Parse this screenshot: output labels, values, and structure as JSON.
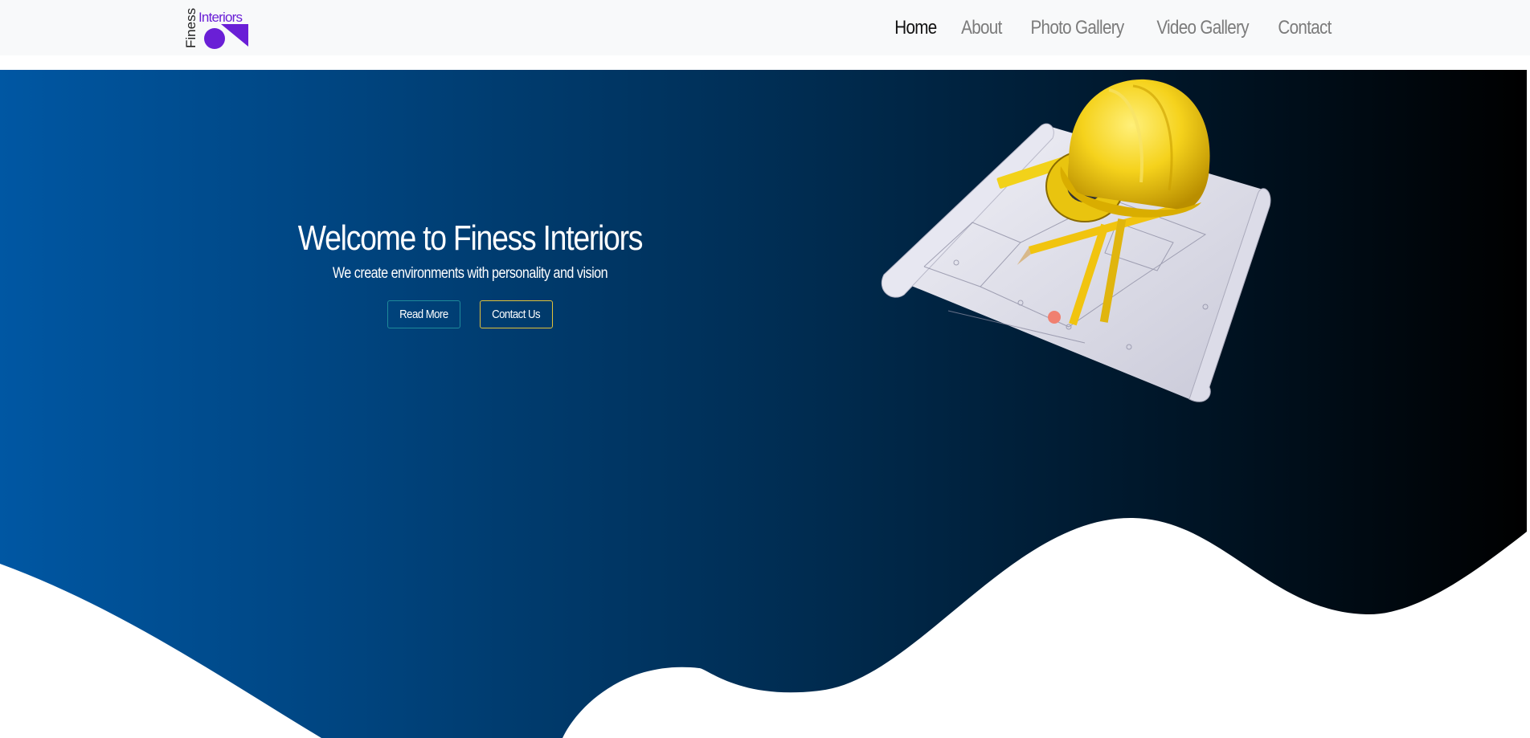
{
  "brand": {
    "logo_word1": "Finess",
    "logo_word2": "Interiors",
    "logo_color": "#6a1fd6"
  },
  "nav": {
    "items": [
      {
        "label": "Home",
        "active": true
      },
      {
        "label": "About",
        "active": false
      },
      {
        "label": "Photo Gallery",
        "active": false
      },
      {
        "label": "Video Gallery",
        "active": false
      },
      {
        "label": "Contact",
        "active": false
      }
    ]
  },
  "hero": {
    "title": "Welcome to Finess Interiors",
    "subtitle": "We create environments with personality and vision",
    "read_more_label": "Read More",
    "contact_label": "Contact Us",
    "gradient_start": "#0057a3",
    "gradient_end": "#000000",
    "image_icon": "hardhat-blueprint-illustration"
  }
}
